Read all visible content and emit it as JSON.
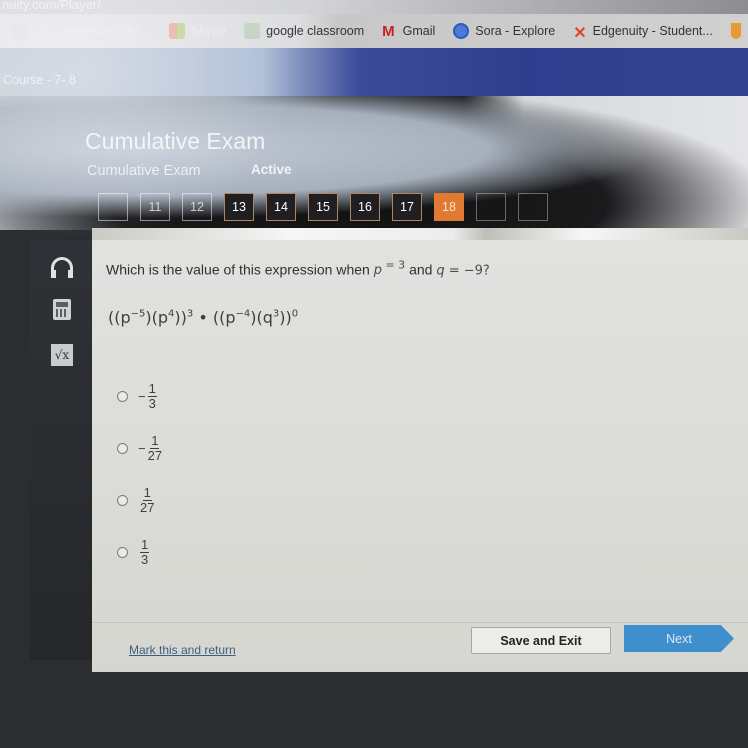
{
  "browser": {
    "url": "nuity.com/Player/",
    "bookmarks": [
      {
        "label": "OKcollegestart - Ac...",
        "icon": "graduation-cap-icon"
      },
      {
        "label": "Skype",
        "icon": "skype-icon"
      },
      {
        "label": "google classroom",
        "icon": "google-classroom-icon"
      },
      {
        "label": "Gmail",
        "icon": "gmail-icon"
      },
      {
        "label": "Sora - Explore",
        "icon": "sora-icon"
      },
      {
        "label": "Edgenuity - Student...",
        "icon": "edgenuity-icon"
      }
    ],
    "gmail_glyph": "M",
    "edgenuity_glyph": "✕"
  },
  "course": {
    "label": "Course - 7- 8"
  },
  "exam": {
    "title": "Cumulative Exam",
    "subtitle": "Cumulative Exam",
    "status": "Active",
    "questions": [
      {
        "label": "",
        "state": "faded"
      },
      {
        "label": "11",
        "state": "faded"
      },
      {
        "label": "12",
        "state": "faded"
      },
      {
        "label": "13",
        "state": "normal"
      },
      {
        "label": "14",
        "state": "normal"
      },
      {
        "label": "15",
        "state": "normal"
      },
      {
        "label": "16",
        "state": "normal"
      },
      {
        "label": "17",
        "state": "normal"
      },
      {
        "label": "18",
        "state": "current"
      },
      {
        "label": "",
        "state": "ghost"
      },
      {
        "label": "",
        "state": "ghost"
      }
    ],
    "current_color": "#e07a33"
  },
  "tools": {
    "audio": "headphones-icon",
    "calculator": "calculator-icon",
    "formula": "square-root-icon",
    "formula_glyph": "√x"
  },
  "question": {
    "prompt": "Which is the value of this expression when",
    "p_var": "p",
    "p_eq": " = 3",
    "and": " and ",
    "q_var": "q",
    "q_eq": " = −9?",
    "expression": {
      "open1": "((p",
      "exp_a": "−5",
      "mid1": ")(p",
      "exp_b": "4",
      "close1": "))",
      "outer1": "3",
      "dot": " • ",
      "open2": "((p",
      "exp_c": "−4",
      "mid2": ")(q",
      "exp_d": "3",
      "close2": "))",
      "outer2": "0"
    },
    "options": [
      {
        "sign": "−",
        "numerator": "1",
        "denominator": "3"
      },
      {
        "sign": "−",
        "numerator": "1",
        "denominator": "27"
      },
      {
        "sign": "",
        "numerator": "1",
        "denominator": "27"
      },
      {
        "sign": "",
        "numerator": "1",
        "denominator": "3"
      }
    ]
  },
  "footer": {
    "mark_link": "Mark this and return",
    "save_button": "Save and Exit",
    "next_button": "Next"
  }
}
